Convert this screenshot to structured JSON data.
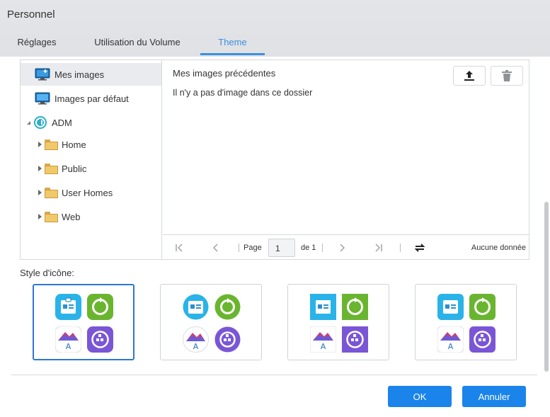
{
  "window": {
    "title": "Personnel"
  },
  "tabs": [
    {
      "label": "Réglages"
    },
    {
      "label": "Utilisation du Volume"
    },
    {
      "label": "Theme"
    }
  ],
  "tree": {
    "items": [
      {
        "label": "Mes images"
      },
      {
        "label": "Images par défaut"
      },
      {
        "label": "ADM"
      },
      {
        "label": "Home"
      },
      {
        "label": "Public"
      },
      {
        "label": "User Homes"
      },
      {
        "label": "Web"
      }
    ]
  },
  "main": {
    "heading": "Mes images précédentes",
    "empty_message": "Il n'y a pas d'image dans ce dossier"
  },
  "pager": {
    "page_label": "Page",
    "page_value": "1",
    "of_label": "de 1",
    "status": "Aucune donnée"
  },
  "icon_style": {
    "label": "Style d'icône:",
    "selected_index": 0
  },
  "buttons": {
    "ok": "OK",
    "cancel": "Annuler"
  },
  "colors": {
    "accent": "#3c8fe0",
    "primary_button": "#1a84ea",
    "selected_border": "#2f77d1"
  }
}
